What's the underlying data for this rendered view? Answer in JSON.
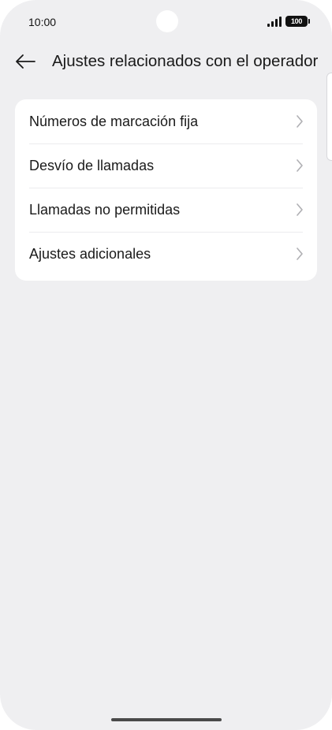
{
  "status_bar": {
    "time": "10:00",
    "battery_level": "100",
    "signal_icon": "signal-bars-icon",
    "battery_icon": "battery-icon"
  },
  "header": {
    "back_icon": "arrow-left-icon",
    "title": "Ajustes relacionados con el operador"
  },
  "menu": {
    "items": [
      {
        "label": "Números de marcación fija",
        "icon": "chevron-right-icon"
      },
      {
        "label": "Desvío de llamadas",
        "icon": "chevron-right-icon"
      },
      {
        "label": "Llamadas no permitidas",
        "icon": "chevron-right-icon"
      },
      {
        "label": "Ajustes adicionales",
        "icon": "chevron-right-icon"
      }
    ]
  },
  "colors": {
    "background": "#efeff1",
    "card": "#ffffff",
    "text": "#1a1a1a",
    "chevron": "#b0b0b4"
  }
}
